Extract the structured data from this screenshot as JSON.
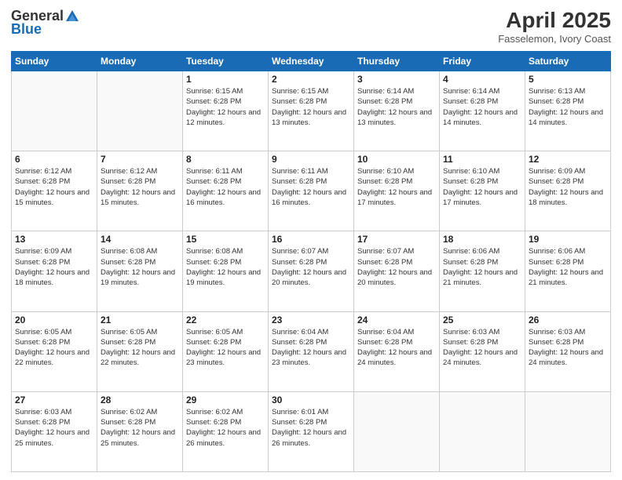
{
  "logo": {
    "general": "General",
    "blue": "Blue"
  },
  "title": "April 2025",
  "subtitle": "Fasselemon, Ivory Coast",
  "days": [
    "Sunday",
    "Monday",
    "Tuesday",
    "Wednesday",
    "Thursday",
    "Friday",
    "Saturday"
  ],
  "weeks": [
    [
      {
        "date": "",
        "info": ""
      },
      {
        "date": "",
        "info": ""
      },
      {
        "date": "1",
        "info": "Sunrise: 6:15 AM\nSunset: 6:28 PM\nDaylight: 12 hours and 12 minutes."
      },
      {
        "date": "2",
        "info": "Sunrise: 6:15 AM\nSunset: 6:28 PM\nDaylight: 12 hours and 13 minutes."
      },
      {
        "date": "3",
        "info": "Sunrise: 6:14 AM\nSunset: 6:28 PM\nDaylight: 12 hours and 13 minutes."
      },
      {
        "date": "4",
        "info": "Sunrise: 6:14 AM\nSunset: 6:28 PM\nDaylight: 12 hours and 14 minutes."
      },
      {
        "date": "5",
        "info": "Sunrise: 6:13 AM\nSunset: 6:28 PM\nDaylight: 12 hours and 14 minutes."
      }
    ],
    [
      {
        "date": "6",
        "info": "Sunrise: 6:12 AM\nSunset: 6:28 PM\nDaylight: 12 hours and 15 minutes."
      },
      {
        "date": "7",
        "info": "Sunrise: 6:12 AM\nSunset: 6:28 PM\nDaylight: 12 hours and 15 minutes."
      },
      {
        "date": "8",
        "info": "Sunrise: 6:11 AM\nSunset: 6:28 PM\nDaylight: 12 hours and 16 minutes."
      },
      {
        "date": "9",
        "info": "Sunrise: 6:11 AM\nSunset: 6:28 PM\nDaylight: 12 hours and 16 minutes."
      },
      {
        "date": "10",
        "info": "Sunrise: 6:10 AM\nSunset: 6:28 PM\nDaylight: 12 hours and 17 minutes."
      },
      {
        "date": "11",
        "info": "Sunrise: 6:10 AM\nSunset: 6:28 PM\nDaylight: 12 hours and 17 minutes."
      },
      {
        "date": "12",
        "info": "Sunrise: 6:09 AM\nSunset: 6:28 PM\nDaylight: 12 hours and 18 minutes."
      }
    ],
    [
      {
        "date": "13",
        "info": "Sunrise: 6:09 AM\nSunset: 6:28 PM\nDaylight: 12 hours and 18 minutes."
      },
      {
        "date": "14",
        "info": "Sunrise: 6:08 AM\nSunset: 6:28 PM\nDaylight: 12 hours and 19 minutes."
      },
      {
        "date": "15",
        "info": "Sunrise: 6:08 AM\nSunset: 6:28 PM\nDaylight: 12 hours and 19 minutes."
      },
      {
        "date": "16",
        "info": "Sunrise: 6:07 AM\nSunset: 6:28 PM\nDaylight: 12 hours and 20 minutes."
      },
      {
        "date": "17",
        "info": "Sunrise: 6:07 AM\nSunset: 6:28 PM\nDaylight: 12 hours and 20 minutes."
      },
      {
        "date": "18",
        "info": "Sunrise: 6:06 AM\nSunset: 6:28 PM\nDaylight: 12 hours and 21 minutes."
      },
      {
        "date": "19",
        "info": "Sunrise: 6:06 AM\nSunset: 6:28 PM\nDaylight: 12 hours and 21 minutes."
      }
    ],
    [
      {
        "date": "20",
        "info": "Sunrise: 6:05 AM\nSunset: 6:28 PM\nDaylight: 12 hours and 22 minutes."
      },
      {
        "date": "21",
        "info": "Sunrise: 6:05 AM\nSunset: 6:28 PM\nDaylight: 12 hours and 22 minutes."
      },
      {
        "date": "22",
        "info": "Sunrise: 6:05 AM\nSunset: 6:28 PM\nDaylight: 12 hours and 23 minutes."
      },
      {
        "date": "23",
        "info": "Sunrise: 6:04 AM\nSunset: 6:28 PM\nDaylight: 12 hours and 23 minutes."
      },
      {
        "date": "24",
        "info": "Sunrise: 6:04 AM\nSunset: 6:28 PM\nDaylight: 12 hours and 24 minutes."
      },
      {
        "date": "25",
        "info": "Sunrise: 6:03 AM\nSunset: 6:28 PM\nDaylight: 12 hours and 24 minutes."
      },
      {
        "date": "26",
        "info": "Sunrise: 6:03 AM\nSunset: 6:28 PM\nDaylight: 12 hours and 24 minutes."
      }
    ],
    [
      {
        "date": "27",
        "info": "Sunrise: 6:03 AM\nSunset: 6:28 PM\nDaylight: 12 hours and 25 minutes."
      },
      {
        "date": "28",
        "info": "Sunrise: 6:02 AM\nSunset: 6:28 PM\nDaylight: 12 hours and 25 minutes."
      },
      {
        "date": "29",
        "info": "Sunrise: 6:02 AM\nSunset: 6:28 PM\nDaylight: 12 hours and 26 minutes."
      },
      {
        "date": "30",
        "info": "Sunrise: 6:01 AM\nSunset: 6:28 PM\nDaylight: 12 hours and 26 minutes."
      },
      {
        "date": "",
        "info": ""
      },
      {
        "date": "",
        "info": ""
      },
      {
        "date": "",
        "info": ""
      }
    ]
  ]
}
